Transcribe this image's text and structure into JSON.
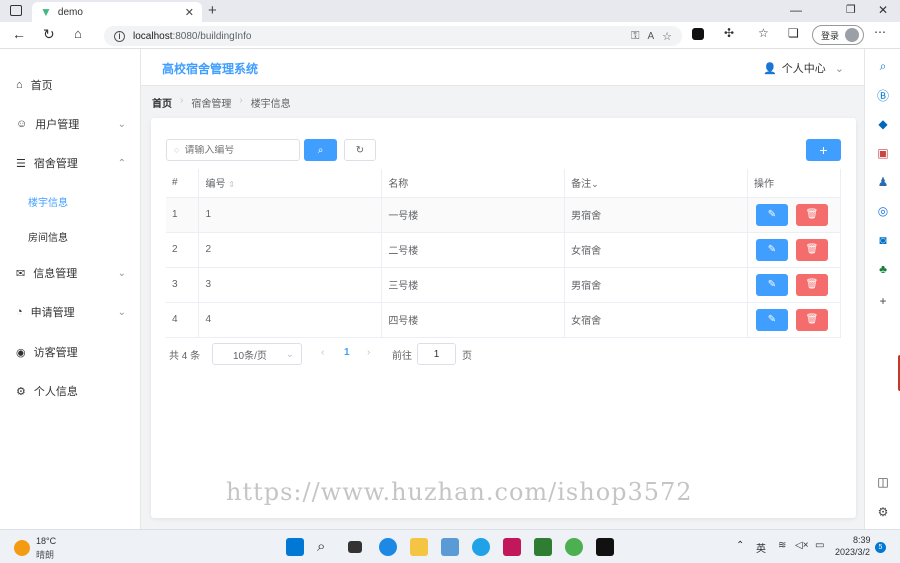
{
  "browser": {
    "tab_title": "demo",
    "url_host": "localhost",
    "url_path": ":8080/buildingInfo",
    "login_label": "登录"
  },
  "app": {
    "title": "高校宿舍管理系统",
    "user_menu": "个人中心"
  },
  "sidebar": {
    "items": [
      {
        "label": "首页"
      },
      {
        "label": "用户管理"
      },
      {
        "label": "宿舍管理"
      },
      {
        "label": "楼宇信息"
      },
      {
        "label": "房间信息"
      },
      {
        "label": "信息管理"
      },
      {
        "label": "申请管理"
      },
      {
        "label": "访客管理"
      },
      {
        "label": "个人信息"
      }
    ]
  },
  "breadcrumb": [
    "首页",
    "宿舍管理",
    "楼宇信息"
  ],
  "search": {
    "placeholder": "请输入编号"
  },
  "table": {
    "headers": [
      "#",
      "编号",
      "名称",
      "备注",
      "操作"
    ],
    "rows": [
      {
        "idx": "1",
        "code": "1",
        "name": "一号楼",
        "note": "男宿舍"
      },
      {
        "idx": "2",
        "code": "2",
        "name": "二号楼",
        "note": "女宿舍"
      },
      {
        "idx": "3",
        "code": "3",
        "name": "三号楼",
        "note": "男宿舍"
      },
      {
        "idx": "4",
        "code": "4",
        "name": "四号楼",
        "note": "女宿舍"
      }
    ]
  },
  "pagination": {
    "total": "共 4 条",
    "page_size": "10条/页",
    "current": "1",
    "goto_prefix": "前往",
    "goto_value": "1",
    "goto_suffix": "页"
  },
  "watermark": "https://www.huzhan.com/ishop3572",
  "taskbar": {
    "weather_temp": "18°C",
    "weather_desc": "晴朗",
    "ime": "英",
    "time": "8:39",
    "date": "2023/3/2",
    "badge": "5"
  },
  "colors": {
    "primary": "#409eff",
    "danger": "#f56c6c",
    "title": "#409eff"
  }
}
